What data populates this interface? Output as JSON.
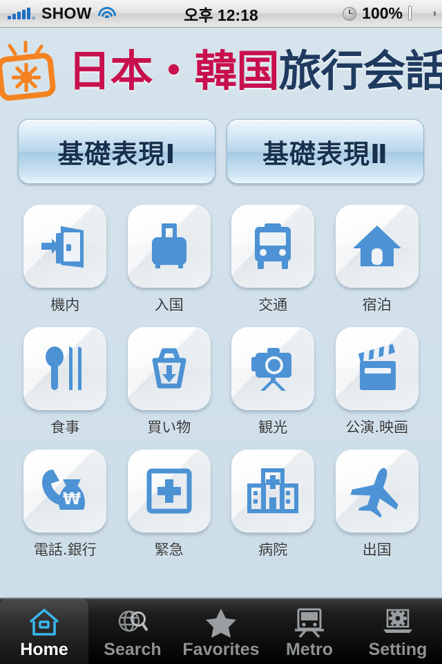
{
  "status_bar": {
    "signal_icon": "signal-bars-icon",
    "carrier": "SHOW",
    "wifi_icon": "wifi-icon",
    "time": "오후 12:18",
    "clock_icon": "clock-icon",
    "battery_percent": "100%",
    "battery_icon": "battery-full-icon",
    "battery_color": "#47bb14"
  },
  "header": {
    "logo_icon": "photo-frame-sun-logo-icon",
    "logo_color": "#f58220",
    "title_part_1": "日本・韓国",
    "title_part_1_color": "#c8104e",
    "title_part_2": "旅行会話",
    "title_part_2_color": "#1f3a5f"
  },
  "top_buttons": [
    {
      "label": "基礎表現Ⅰ",
      "name": "basic-expressions-1"
    },
    {
      "label": "基礎表現Ⅱ",
      "name": "basic-expressions-2"
    }
  ],
  "grid": {
    "icon_color": "#4c92d4",
    "items": [
      {
        "label": "機内",
        "icon": "door-enter-icon",
        "name": "in-flight"
      },
      {
        "label": "入国",
        "icon": "suitcase-icon",
        "name": "immigration"
      },
      {
        "label": "交通",
        "icon": "bus-icon",
        "name": "transportation"
      },
      {
        "label": "宿泊",
        "icon": "house-icon",
        "name": "accommodation"
      },
      {
        "label": "食事",
        "icon": "spoon-chopsticks-icon",
        "name": "dining"
      },
      {
        "label": "買い物",
        "icon": "shopping-basket-icon",
        "name": "shopping"
      },
      {
        "label": "観光",
        "icon": "camera-tripod-icon",
        "name": "sightseeing"
      },
      {
        "label": "公演.映画",
        "icon": "clapperboard-icon",
        "name": "shows-movies"
      },
      {
        "label": "電話.銀行",
        "icon": "phone-moneybag-icon",
        "name": "phone-bank"
      },
      {
        "label": "緊急",
        "icon": "cross-square-icon",
        "name": "emergency"
      },
      {
        "label": "病院",
        "icon": "hospital-icon",
        "name": "hospital"
      },
      {
        "label": "出国",
        "icon": "airplane-icon",
        "name": "departure"
      }
    ]
  },
  "tab_bar": {
    "active_index": 0,
    "active_color": "#3ab7f0",
    "inactive_color": "#8e9295",
    "tabs": [
      {
        "label": "Home",
        "icon": "home-icon",
        "name": "tab-home"
      },
      {
        "label": "Search",
        "icon": "globe-search-icon",
        "name": "tab-search"
      },
      {
        "label": "Favorites",
        "icon": "star-icon",
        "name": "tab-favorites"
      },
      {
        "label": "Metro",
        "icon": "train-icon",
        "name": "tab-metro"
      },
      {
        "label": "Setting",
        "icon": "laptop-gear-icon",
        "name": "tab-setting"
      }
    ]
  }
}
